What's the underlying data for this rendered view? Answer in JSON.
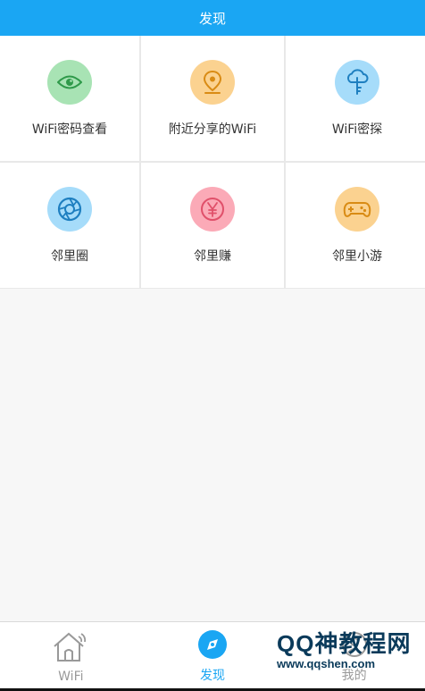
{
  "header": {
    "title": "发现"
  },
  "tiles": [
    {
      "label": "WiFi密码查看",
      "icon": "eye-icon",
      "color": "#a8e3b4"
    },
    {
      "label": "附近分享的WiFi",
      "icon": "location-pin-icon",
      "color": "#fbd290"
    },
    {
      "label": "WiFi密探",
      "icon": "cloud-key-icon",
      "color": "#a6dcfa"
    },
    {
      "label": "邻里圈",
      "icon": "aperture-icon",
      "color": "#a6dcfa"
    },
    {
      "label": "邻里赚",
      "icon": "yen-coin-icon",
      "color": "#fbaab7"
    },
    {
      "label": "邻里小游",
      "icon": "gamepad-icon",
      "color": "#fbd290"
    }
  ],
  "tabbar": {
    "items": [
      {
        "label": "WiFi",
        "icon": "home-wifi-icon",
        "active": false
      },
      {
        "label": "发现",
        "icon": "discover-icon",
        "active": true
      },
      {
        "label": "我的",
        "icon": "profile-icon",
        "active": false
      }
    ]
  },
  "watermark": {
    "title": "QQ神教程网",
    "url": "www.qqshen.com"
  },
  "colors": {
    "accent": "#1aa6f3",
    "background": "#f7f7f7"
  }
}
